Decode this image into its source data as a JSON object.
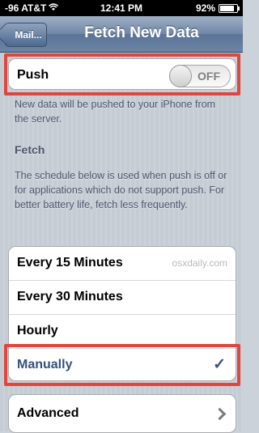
{
  "status_bar": {
    "carrier": "-96 AT&T",
    "time": "12:41 PM",
    "battery_percent": "92%",
    "battery_level": 0.92
  },
  "nav": {
    "back_label": "Mail...",
    "title": "Fetch New Data"
  },
  "push": {
    "label": "Push",
    "switch_state": "OFF",
    "note": "New data will be pushed to your iPhone from the server."
  },
  "fetch": {
    "header": "Fetch",
    "note": "The schedule below is used when push is off or for applications which do not support push. For better battery life, fetch less frequently.",
    "options": [
      {
        "label": "Every 15 Minutes",
        "selected": false
      },
      {
        "label": "Every 30 Minutes",
        "selected": false
      },
      {
        "label": "Hourly",
        "selected": false
      },
      {
        "label": "Manually",
        "selected": true
      }
    ],
    "watermark": "osxdaily.com"
  },
  "advanced": {
    "label": "Advanced"
  },
  "colors": {
    "highlight": "#e0463d",
    "selected_text": "#34527d"
  },
  "icons": [
    "signal-bars-icon",
    "wifi-icon",
    "battery-icon",
    "checkmark-icon",
    "chevron-right-icon"
  ]
}
